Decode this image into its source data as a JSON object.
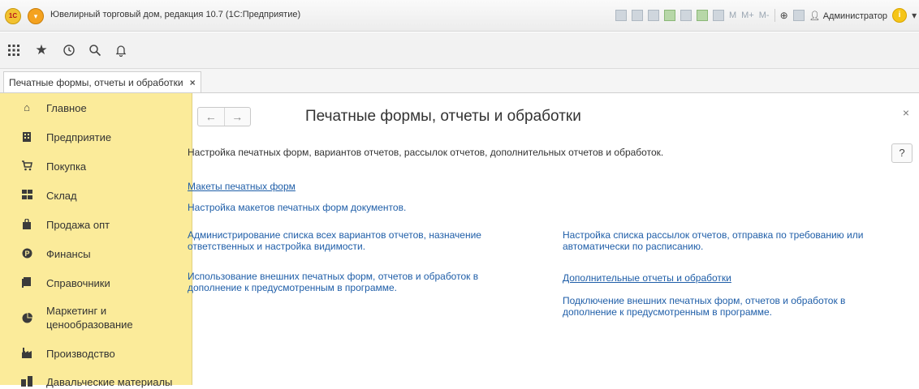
{
  "window": {
    "title": "Ювелирный торговый дом, редакция 10.7  (1С:Предприятие)",
    "logo_text": "1С",
    "memory_buttons": [
      "M",
      "M+",
      "M-"
    ],
    "user": "Администратор",
    "info_label": "i",
    "minimize_label": "–",
    "restore_label": "□",
    "close_label": "X"
  },
  "tab": {
    "label": "Печатные формы, отчеты и обработки",
    "close": "×"
  },
  "sidebar": {
    "items": [
      {
        "label": "Главное",
        "icon": "home-icon"
      },
      {
        "label": "Предприятие",
        "icon": "building-icon"
      },
      {
        "label": "Покупка",
        "icon": "cart-icon"
      },
      {
        "label": "Склад",
        "icon": "warehouse-icon"
      },
      {
        "label": "Продажа опт",
        "icon": "bag-icon"
      },
      {
        "label": "Финансы",
        "icon": "finance-icon"
      },
      {
        "label": "Справочники",
        "icon": "book-icon"
      },
      {
        "label": "Маркетинг и ценообразование",
        "icon": "pie-chart-icon"
      },
      {
        "label": "Производство",
        "icon": "factory-icon"
      },
      {
        "label": "Давальческие материалы",
        "icon": "materials-icon"
      }
    ]
  },
  "main": {
    "back": "←",
    "forward": "→",
    "title": "Печатные формы, отчеты и обработки",
    "close": "×",
    "help": "?",
    "description": "Настройка печатных форм, вариантов отчетов, рассылок отчетов, дополнительных отчетов и обработок.",
    "left": {
      "link1": "Макеты печатных форм",
      "link1_desc": "Настройка макетов печатных форм документов.",
      "link2": "Администрирование списка всех вариантов отчетов, назначение ответственных и настройка видимости.",
      "link3": "Использование внешних печатных форм, отчетов и обработок в дополнение к предусмотренным в программе."
    },
    "right": {
      "link1": "Настройка списка рассылок отчетов, отправка по требованию или автоматически по расписанию.",
      "link2": "Дополнительные отчеты и обработки",
      "link2_desc": "Подключение внешних печатных форм, отчетов и обработок в дополнение к предусмотренным в программе."
    }
  }
}
